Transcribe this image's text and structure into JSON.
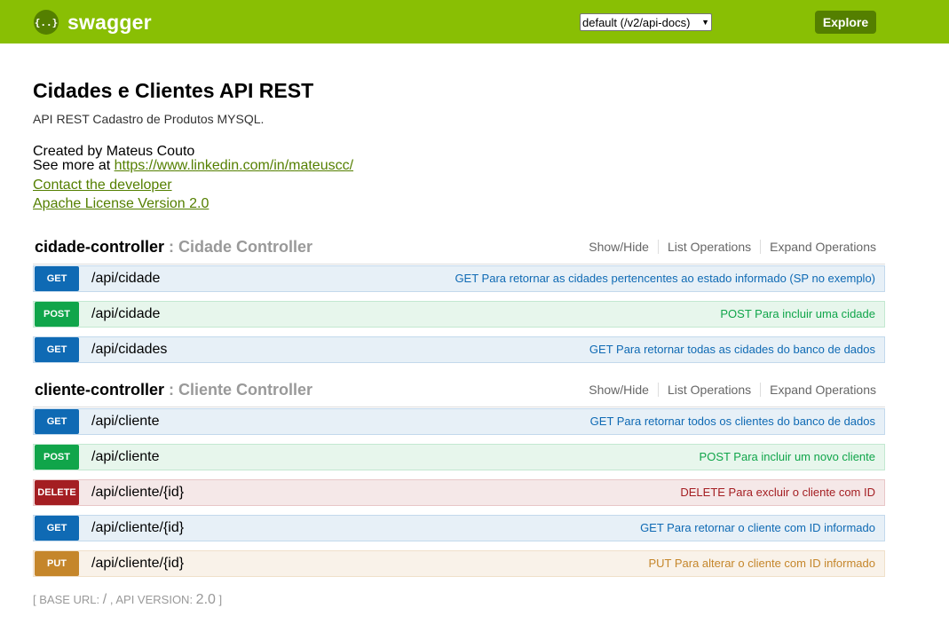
{
  "header": {
    "logo_icon": "{..}",
    "logo_text": "swagger",
    "api_select_value": "default (/v2/api-docs)",
    "explore_label": "Explore",
    "colors": {
      "bar": "#89bf04",
      "button": "#547f00"
    }
  },
  "info": {
    "title": "Cidades e Clientes API REST",
    "description": "API REST Cadastro de Produtos MYSQL.",
    "created_by": "Created by Mateus Couto",
    "see_more_prefix": "See more at ",
    "see_more_link": "https://www.linkedin.com/in/mateuscc/",
    "contact_link": "Contact the developer",
    "license_link": "Apache License Version 2.0"
  },
  "options": {
    "show_hide": "Show/Hide",
    "list_operations": "List Operations",
    "expand_operations": "Expand Operations"
  },
  "resources": [
    {
      "name": "cidade-controller",
      "separator": " : ",
      "description": "Cidade Controller",
      "operations": [
        {
          "method": "GET",
          "path": "/api/cidade",
          "summary": "GET Para retornar as cidades pertencentes ao estado informado (SP no exemplo)"
        },
        {
          "method": "POST",
          "path": "/api/cidade",
          "summary": "POST Para incluir uma cidade"
        },
        {
          "method": "GET",
          "path": "/api/cidades",
          "summary": "GET Para retornar todas as cidades do banco de dados"
        }
      ]
    },
    {
      "name": "cliente-controller",
      "separator": " : ",
      "description": "Cliente Controller",
      "operations": [
        {
          "method": "GET",
          "path": "/api/cliente",
          "summary": "GET Para retornar todos os clientes do banco de dados"
        },
        {
          "method": "POST",
          "path": "/api/cliente",
          "summary": "POST Para incluir um novo cliente"
        },
        {
          "method": "DELETE",
          "path": "/api/cliente/{id}",
          "summary": "DELETE Para excluir o cliente com ID"
        },
        {
          "method": "GET",
          "path": "/api/cliente/{id}",
          "summary": "GET Para retornar o cliente com ID informado"
        },
        {
          "method": "PUT",
          "path": "/api/cliente/{id}",
          "summary": "PUT Para alterar o cliente com ID informado"
        }
      ]
    }
  ],
  "footer": {
    "open": "[ ",
    "base_url_label": "BASE URL",
    "base_url_sep": ": ",
    "base_url_value": "/",
    "api_version_sep": " , ",
    "api_version_label": "API VERSION",
    "api_version_sep2": ": ",
    "api_version_value": "2.0",
    "close": " ]"
  },
  "method_colors": {
    "GET": "#0f6ab4",
    "POST": "#10a54a",
    "DELETE": "#a41e22",
    "PUT": "#c5862b"
  }
}
